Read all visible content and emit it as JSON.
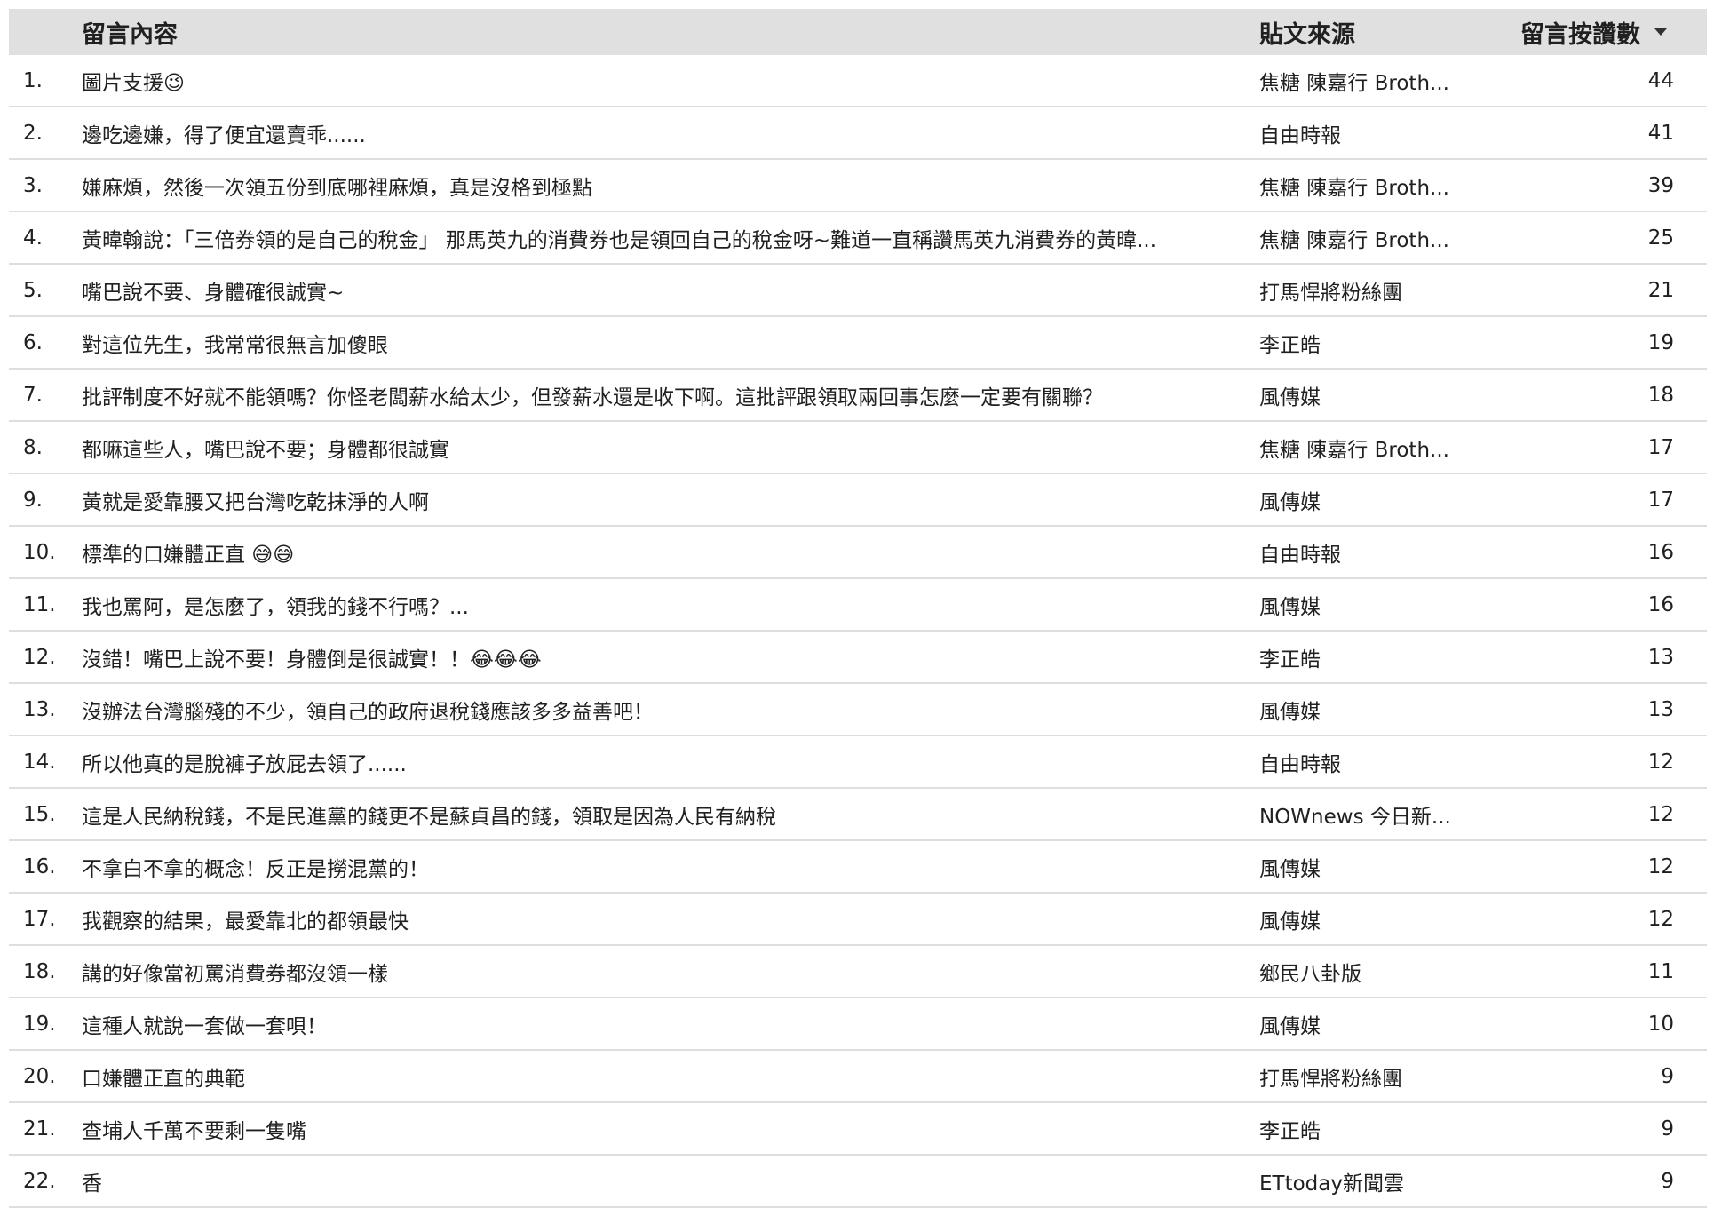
{
  "table": {
    "headers": {
      "message": "留言內容",
      "source": "貼文來源",
      "likes": "留言按讚數"
    },
    "sort_icon": "sort-descending-icon",
    "rows": [
      {
        "idx": "1.",
        "message": "圖片支援😉",
        "source": "焦糖 陳嘉行 Broth...",
        "likes": "44"
      },
      {
        "idx": "2.",
        "message": "邊吃邊嫌，得了便宜還賣乖......",
        "source": "自由時報",
        "likes": "41"
      },
      {
        "idx": "3.",
        "message": "嫌麻煩，然後一次領五份到底哪裡麻煩，真是沒格到極點",
        "source": "焦糖 陳嘉行 Broth...",
        "likes": "39"
      },
      {
        "idx": "4.",
        "message": "黃暐翰說：「三倍券領的是自己的稅金」 那馬英九的消費券也是領回自己的稅金呀~難道一直稱讚馬英九消費券的黃暐...",
        "source": "焦糖 陳嘉行 Broth...",
        "likes": "25"
      },
      {
        "idx": "5.",
        "message": "嘴巴說不要、身體確很誠實~",
        "source": "打馬悍將粉絲團",
        "likes": "21"
      },
      {
        "idx": "6.",
        "message": "對這位先生，我常常很無言加傻眼",
        "source": "李正皓",
        "likes": "19"
      },
      {
        "idx": "7.",
        "message": "批評制度不好就不能領嗎？你怪老闆薪水給太少，但發薪水還是收下啊。這批評跟領取兩回事怎麼一定要有關聯？",
        "source": "風傳媒",
        "likes": "18"
      },
      {
        "idx": "8.",
        "message": "都嘛這些人，嘴巴說不要；身體都很誠實",
        "source": "焦糖 陳嘉行 Broth...",
        "likes": "17"
      },
      {
        "idx": "9.",
        "message": "黃就是愛靠腰又把台灣吃乾抹淨的人啊",
        "source": "風傳媒",
        "likes": "17"
      },
      {
        "idx": "10.",
        "message": "標準的口嫌體正直 😅😅",
        "source": "自由時報",
        "likes": "16"
      },
      {
        "idx": "11.",
        "message": "我也罵阿，是怎麼了，領我的錢不行嗎？...",
        "source": "風傳媒",
        "likes": "16"
      },
      {
        "idx": "12.",
        "message": "沒錯！嘴巴上說不要！身體倒是很誠實！！😂😂😂",
        "source": "李正皓",
        "likes": "13"
      },
      {
        "idx": "13.",
        "message": "沒辦法台灣腦殘的不少，領自己的政府退稅錢應該多多益善吧！",
        "source": "風傳媒",
        "likes": "13"
      },
      {
        "idx": "14.",
        "message": "所以他真的是脫褲子放屁去領了......",
        "source": "自由時報",
        "likes": "12"
      },
      {
        "idx": "15.",
        "message": "這是人民納稅錢，不是民進黨的錢更不是蘇貞昌的錢，領取是因為人民有納稅",
        "source": "NOWnews 今日新...",
        "likes": "12"
      },
      {
        "idx": "16.",
        "message": "不拿白不拿的概念！反正是撈混黨的！",
        "source": "風傳媒",
        "likes": "12"
      },
      {
        "idx": "17.",
        "message": "我觀察的結果，最愛靠北的都領最快",
        "source": "風傳媒",
        "likes": "12"
      },
      {
        "idx": "18.",
        "message": "講的好像當初罵消費券都沒領一樣",
        "source": "鄉民八卦版",
        "likes": "11"
      },
      {
        "idx": "19.",
        "message": "這種人就說一套做一套唄！",
        "source": "風傳媒",
        "likes": "10"
      },
      {
        "idx": "20.",
        "message": "口嫌體正直的典範",
        "source": "打馬悍將粉絲團",
        "likes": "9"
      },
      {
        "idx": "21.",
        "message": "查埔人千萬不要剩一隻嘴",
        "source": "李正皓",
        "likes": "9"
      },
      {
        "idx": "22.",
        "message": "香",
        "source": "ETtoday新聞雲",
        "likes": "9"
      }
    ]
  }
}
